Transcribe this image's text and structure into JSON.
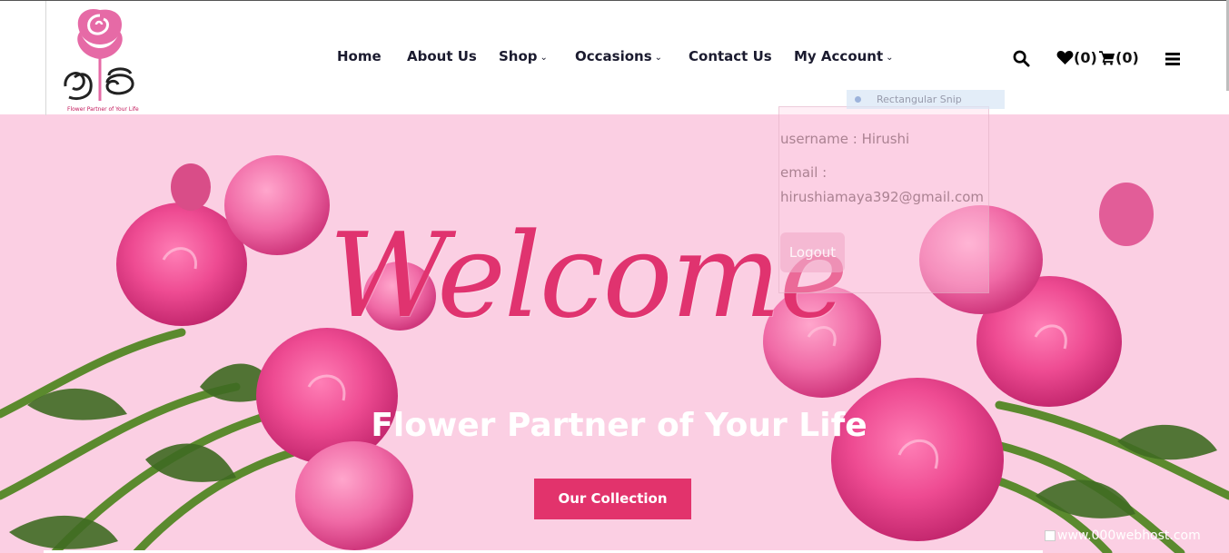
{
  "logo": {
    "tagline": "Flower Partner of Your Life"
  },
  "nav": {
    "items": [
      {
        "label": "Home",
        "has_dropdown": false
      },
      {
        "label": "About Us",
        "has_dropdown": false
      },
      {
        "label": "Shop",
        "has_dropdown": true
      },
      {
        "label": "Occasions",
        "has_dropdown": true
      },
      {
        "label": "Contact Us",
        "has_dropdown": false
      },
      {
        "label": "My Account",
        "has_dropdown": true
      }
    ]
  },
  "header_icons": {
    "search_icon": "search-icon",
    "wishlist_icon": "heart-icon",
    "wishlist_count": "(0)",
    "cart_icon": "cart-icon",
    "cart_count": "(0)",
    "menu_icon": "hamburger-icon"
  },
  "account_dropdown": {
    "username_line": "username : Hirushi",
    "email_label": "email :",
    "email_value": "hirushiamaya392@gmail.com",
    "logout_label": "Logout"
  },
  "snip_overlay": {
    "label": "Rectangular Snip"
  },
  "hero": {
    "heading": "Welcome",
    "tagline": "Flower Partner of Your Life",
    "cta_label": "Our Collection"
  },
  "watermark": {
    "text": "www.000webhost.com"
  },
  "colors": {
    "accent": "#e2336c",
    "hero_bg": "#fbcfe3",
    "welcome_text": "#e0336f",
    "nav_text": "#1b1b2f"
  }
}
